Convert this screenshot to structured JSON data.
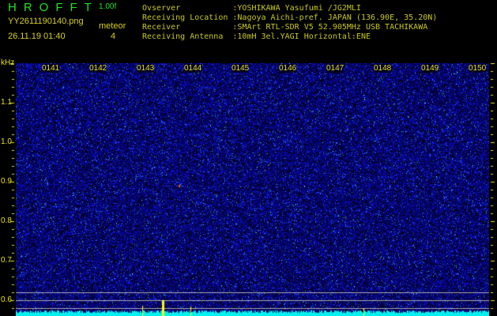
{
  "header": {
    "logo": "HROFFT",
    "version": "1.00f",
    "filename": "YY2611190140.png",
    "datetime": "26.11.19 01:40",
    "meteor_label": "meteor",
    "meteor_count": "4",
    "info": [
      "Ovserver           :YOSHIKAWA Yasufumi /JG2MLI",
      "Receiving Location :Nagoya Aichi-pref. JAPAN (136.90E, 35.20N)",
      "Receiver           :SMArt RTL-SDR V5 52.905MHz USB TACHIKAWA",
      "Receiving Antenna  :10mH 3el.YAGI Horizontal:ENE"
    ]
  },
  "axis": {
    "y_unit": "kHz",
    "y_labels": [
      "1.1",
      "1.0",
      "0.9",
      "0.8",
      "0.7",
      "0.6"
    ],
    "time_labels": [
      "0141",
      "0142",
      "0143",
      "0144",
      "0145",
      "0146",
      "0147",
      "0148",
      "0149",
      "0150"
    ]
  },
  "colors": {
    "background": "#000000",
    "noise": "#1a1acc",
    "baseline": "#00f0f0",
    "marker": "#ffff00"
  }
}
